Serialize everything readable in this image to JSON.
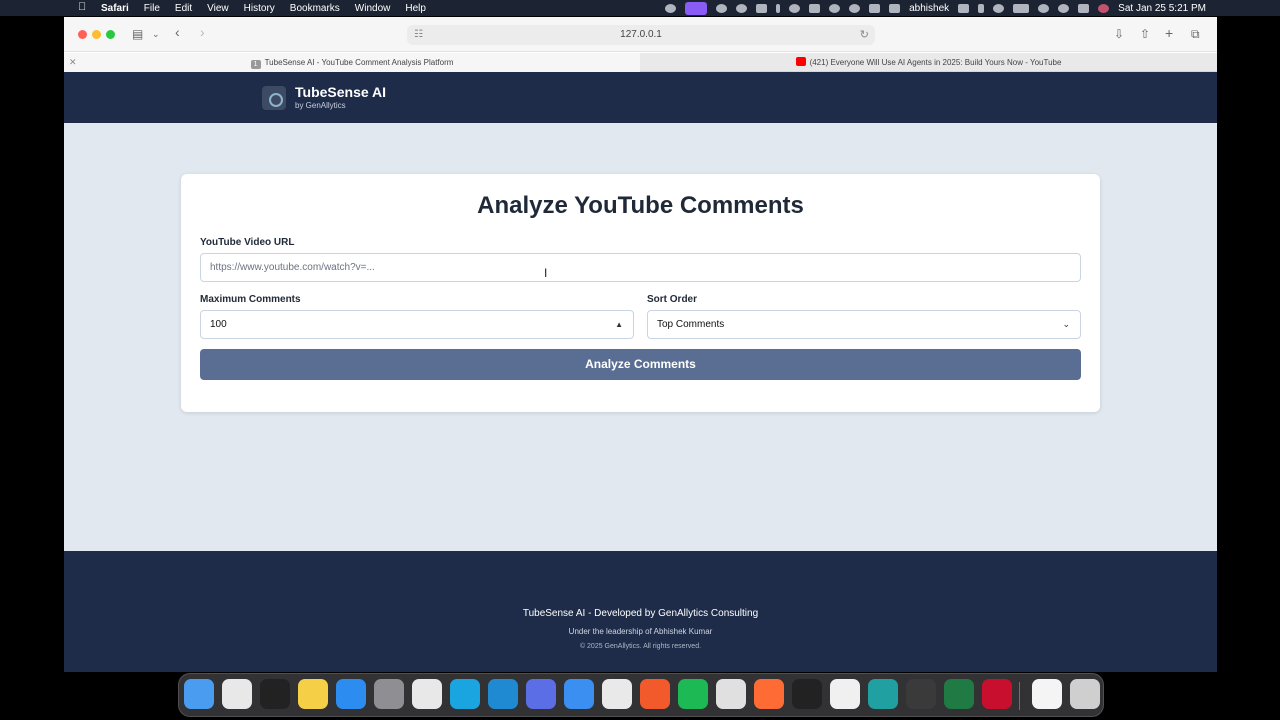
{
  "menubar": {
    "apple": "",
    "app": "Safari",
    "items": [
      "File",
      "Edit",
      "View",
      "History",
      "Bookmarks",
      "Window",
      "Help"
    ],
    "user": "abhishek",
    "datetime": "Sat Jan 25  5:21 PM"
  },
  "browser": {
    "url": "127.0.0.1",
    "tabs": [
      {
        "badge": "1",
        "title": "TubeSense AI - YouTube Comment Analysis Platform"
      },
      {
        "title": "(421) Everyone Will Use AI Agents in 2025: Build Yours Now - YouTube"
      }
    ]
  },
  "header": {
    "brand": "TubeSense AI",
    "sub": "by GenAllytics"
  },
  "form": {
    "title": "Analyze YouTube Comments",
    "url_label": "YouTube Video URL",
    "url_placeholder": "https://www.youtube.com/watch?v=...",
    "max_label": "Maximum Comments",
    "max_value": "100",
    "sort_label": "Sort Order",
    "sort_value": "Top Comments",
    "submit": "Analyze Comments"
  },
  "footer": {
    "line1": "TubeSense AI - Developed by GenAllytics Consulting",
    "line2": "Under the leadership of Abhishek Kumar",
    "line3": "© 2025 GenAllytics. All rights reserved."
  },
  "colors": {
    "header_bg": "#1e2c49",
    "page_bg": "#e2e8f0",
    "button_bg": "#5a6e94"
  },
  "dock": {
    "apps": [
      "finder-icon",
      "launchpad-icon",
      "terminal-icon",
      "notes-icon",
      "app-store-icon",
      "system-settings-icon",
      "slack-icon",
      "webstorm-icon",
      "vscode-icon",
      "affinity-icon",
      "safari-icon",
      "chrome-icon",
      "brave-icon",
      "spotify-icon",
      "pencil-app-icon",
      "swift-icon",
      "cube-app-icon",
      "chatgpt-icon",
      "perplexity-icon",
      "obs-icon",
      "excel-icon",
      "acrobat-icon",
      "document-icon",
      "trash-icon"
    ]
  }
}
